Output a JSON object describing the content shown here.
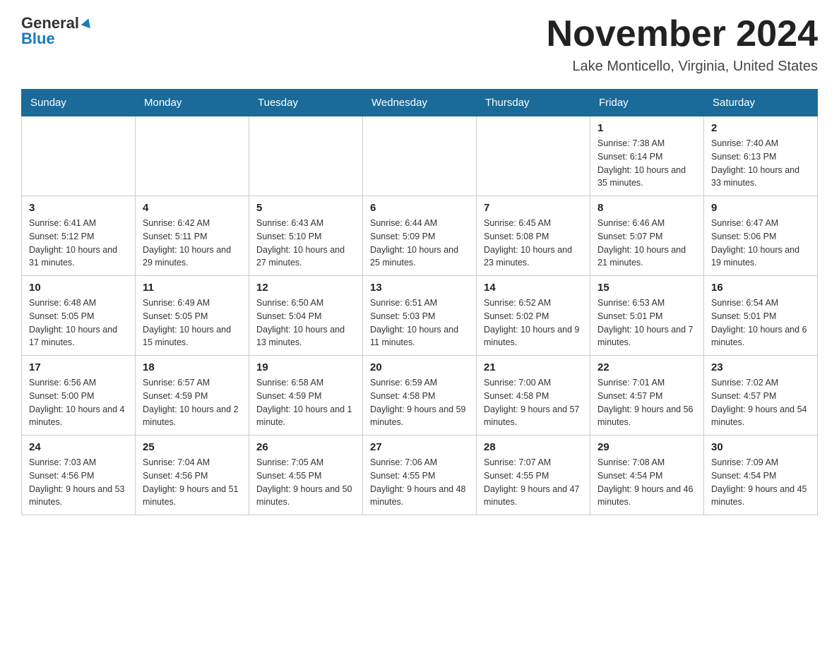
{
  "header": {
    "logo_general": "General",
    "logo_blue": "Blue",
    "month_title": "November 2024",
    "location": "Lake Monticello, Virginia, United States"
  },
  "days_of_week": [
    "Sunday",
    "Monday",
    "Tuesday",
    "Wednesday",
    "Thursday",
    "Friday",
    "Saturday"
  ],
  "weeks": [
    [
      {
        "day": "",
        "info": ""
      },
      {
        "day": "",
        "info": ""
      },
      {
        "day": "",
        "info": ""
      },
      {
        "day": "",
        "info": ""
      },
      {
        "day": "",
        "info": ""
      },
      {
        "day": "1",
        "info": "Sunrise: 7:38 AM\nSunset: 6:14 PM\nDaylight: 10 hours and 35 minutes."
      },
      {
        "day": "2",
        "info": "Sunrise: 7:40 AM\nSunset: 6:13 PM\nDaylight: 10 hours and 33 minutes."
      }
    ],
    [
      {
        "day": "3",
        "info": "Sunrise: 6:41 AM\nSunset: 5:12 PM\nDaylight: 10 hours and 31 minutes."
      },
      {
        "day": "4",
        "info": "Sunrise: 6:42 AM\nSunset: 5:11 PM\nDaylight: 10 hours and 29 minutes."
      },
      {
        "day": "5",
        "info": "Sunrise: 6:43 AM\nSunset: 5:10 PM\nDaylight: 10 hours and 27 minutes."
      },
      {
        "day": "6",
        "info": "Sunrise: 6:44 AM\nSunset: 5:09 PM\nDaylight: 10 hours and 25 minutes."
      },
      {
        "day": "7",
        "info": "Sunrise: 6:45 AM\nSunset: 5:08 PM\nDaylight: 10 hours and 23 minutes."
      },
      {
        "day": "8",
        "info": "Sunrise: 6:46 AM\nSunset: 5:07 PM\nDaylight: 10 hours and 21 minutes."
      },
      {
        "day": "9",
        "info": "Sunrise: 6:47 AM\nSunset: 5:06 PM\nDaylight: 10 hours and 19 minutes."
      }
    ],
    [
      {
        "day": "10",
        "info": "Sunrise: 6:48 AM\nSunset: 5:05 PM\nDaylight: 10 hours and 17 minutes."
      },
      {
        "day": "11",
        "info": "Sunrise: 6:49 AM\nSunset: 5:05 PM\nDaylight: 10 hours and 15 minutes."
      },
      {
        "day": "12",
        "info": "Sunrise: 6:50 AM\nSunset: 5:04 PM\nDaylight: 10 hours and 13 minutes."
      },
      {
        "day": "13",
        "info": "Sunrise: 6:51 AM\nSunset: 5:03 PM\nDaylight: 10 hours and 11 minutes."
      },
      {
        "day": "14",
        "info": "Sunrise: 6:52 AM\nSunset: 5:02 PM\nDaylight: 10 hours and 9 minutes."
      },
      {
        "day": "15",
        "info": "Sunrise: 6:53 AM\nSunset: 5:01 PM\nDaylight: 10 hours and 7 minutes."
      },
      {
        "day": "16",
        "info": "Sunrise: 6:54 AM\nSunset: 5:01 PM\nDaylight: 10 hours and 6 minutes."
      }
    ],
    [
      {
        "day": "17",
        "info": "Sunrise: 6:56 AM\nSunset: 5:00 PM\nDaylight: 10 hours and 4 minutes."
      },
      {
        "day": "18",
        "info": "Sunrise: 6:57 AM\nSunset: 4:59 PM\nDaylight: 10 hours and 2 minutes."
      },
      {
        "day": "19",
        "info": "Sunrise: 6:58 AM\nSunset: 4:59 PM\nDaylight: 10 hours and 1 minute."
      },
      {
        "day": "20",
        "info": "Sunrise: 6:59 AM\nSunset: 4:58 PM\nDaylight: 9 hours and 59 minutes."
      },
      {
        "day": "21",
        "info": "Sunrise: 7:00 AM\nSunset: 4:58 PM\nDaylight: 9 hours and 57 minutes."
      },
      {
        "day": "22",
        "info": "Sunrise: 7:01 AM\nSunset: 4:57 PM\nDaylight: 9 hours and 56 minutes."
      },
      {
        "day": "23",
        "info": "Sunrise: 7:02 AM\nSunset: 4:57 PM\nDaylight: 9 hours and 54 minutes."
      }
    ],
    [
      {
        "day": "24",
        "info": "Sunrise: 7:03 AM\nSunset: 4:56 PM\nDaylight: 9 hours and 53 minutes."
      },
      {
        "day": "25",
        "info": "Sunrise: 7:04 AM\nSunset: 4:56 PM\nDaylight: 9 hours and 51 minutes."
      },
      {
        "day": "26",
        "info": "Sunrise: 7:05 AM\nSunset: 4:55 PM\nDaylight: 9 hours and 50 minutes."
      },
      {
        "day": "27",
        "info": "Sunrise: 7:06 AM\nSunset: 4:55 PM\nDaylight: 9 hours and 48 minutes."
      },
      {
        "day": "28",
        "info": "Sunrise: 7:07 AM\nSunset: 4:55 PM\nDaylight: 9 hours and 47 minutes."
      },
      {
        "day": "29",
        "info": "Sunrise: 7:08 AM\nSunset: 4:54 PM\nDaylight: 9 hours and 46 minutes."
      },
      {
        "day": "30",
        "info": "Sunrise: 7:09 AM\nSunset: 4:54 PM\nDaylight: 9 hours and 45 minutes."
      }
    ]
  ]
}
